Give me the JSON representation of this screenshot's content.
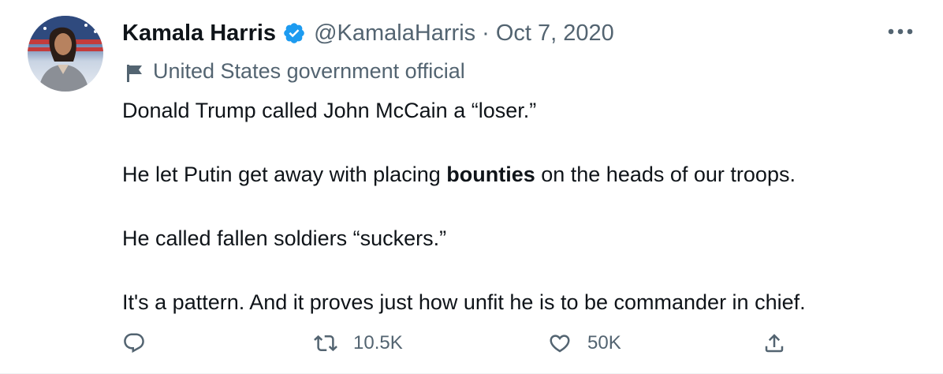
{
  "author": {
    "name": "Kamala Harris",
    "handle": "@KamalaHarris",
    "separator": "·",
    "date": "Oct 7, 2020",
    "verified_icon": "verified-badge-icon",
    "label": "United States government official",
    "label_icon": "flag-icon"
  },
  "tweet": {
    "lines": [
      "Donald Trump called John McCain a “loser.”",
      "He let Putin get away with placing ",
      "bounties",
      " on the heads of our troops.",
      "He called fallen soldiers “suckers.”",
      "It's a pattern. And it proves just how unfit he is to be commander in chief."
    ]
  },
  "actions": {
    "reply": {
      "icon": "reply-icon",
      "count": ""
    },
    "retweet": {
      "icon": "retweet-icon",
      "count": "10.5K"
    },
    "like": {
      "icon": "like-icon",
      "count": "50K"
    },
    "share": {
      "icon": "share-icon"
    },
    "more_icon": "more-options-icon"
  },
  "colors": {
    "primary_text": "#0f1419",
    "secondary_text": "#536471",
    "verified": "#1d9bf0"
  }
}
